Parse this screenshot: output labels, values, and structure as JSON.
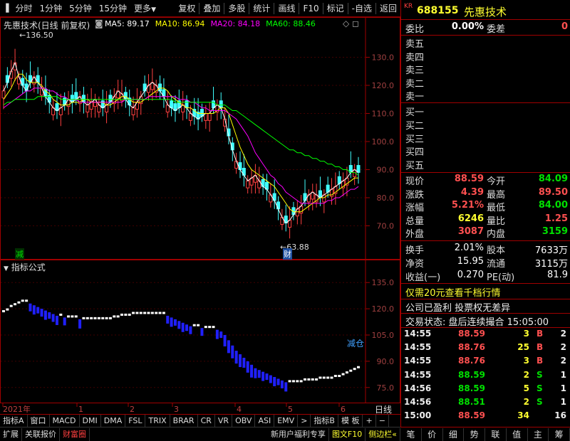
{
  "toolbar": {
    "periods": [
      "分时",
      "1分钟",
      "5分钟",
      "15分钟",
      "更多"
    ],
    "actions": [
      "复权",
      "叠加",
      "多股",
      "统计",
      "画线",
      "F10",
      "标记",
      "-自选",
      "返回"
    ]
  },
  "main": {
    "title": "先惠技术(日线 前复权)",
    "ma_legend": [
      {
        "label": "MA5: 89.17",
        "color": "#ffffff"
      },
      {
        "label": "MA10: 86.94",
        "color": "#ffff00"
      },
      {
        "label": "MA20: 84.18",
        "color": "#ff00ff"
      },
      {
        "label": "MA60: 88.46",
        "color": "#00ff00"
      }
    ],
    "high_label": "136.50",
    "low_label": "63.88",
    "marker_jian": "减",
    "marker_cai": "财"
  },
  "indicator": {
    "title": "指标公式",
    "annotation": "减仓"
  },
  "chart_data": [
    {
      "type": "candlestick",
      "title": "先惠技术(日线 前复权)",
      "y_ticks": [
        130.0,
        120.0,
        110.0,
        100.0,
        90.0,
        80.0,
        70.0
      ],
      "ylim": [
        61,
        140
      ],
      "x_ticks": [
        "2021年",
        "1",
        "2",
        "3",
        "4",
        "5",
        "6"
      ],
      "series": [
        {
          "name": "MA5",
          "color": "#ffffff",
          "values": [
            118,
            121,
            125,
            128,
            123,
            120,
            118,
            121,
            123,
            121,
            119,
            116,
            114,
            112,
            111,
            112,
            113,
            115,
            114,
            115,
            116,
            114,
            113,
            114,
            115,
            113,
            112,
            113,
            114,
            116,
            118,
            117,
            115,
            113,
            112,
            114,
            116,
            118,
            120,
            121,
            120,
            118,
            116,
            113,
            112,
            111,
            112,
            113,
            112,
            110,
            109,
            108,
            109,
            110,
            110,
            112,
            113,
            112,
            108,
            102,
            97,
            93,
            90,
            88,
            86,
            87,
            88,
            86,
            84,
            83,
            81,
            79,
            76,
            73,
            71,
            72,
            74,
            76,
            77,
            79,
            81,
            82,
            81,
            80,
            81,
            82,
            83,
            84,
            85,
            86,
            87,
            89,
            90,
            89
          ]
        },
        {
          "name": "MA10",
          "color": "#ffff00",
          "values": [
            115,
            117,
            119,
            122,
            124,
            124,
            122,
            121,
            121,
            121,
            120,
            118,
            117,
            115,
            114,
            113,
            113,
            113,
            114,
            114,
            114,
            115,
            115,
            114,
            114,
            114,
            114,
            113,
            113,
            114,
            115,
            116,
            116,
            115,
            114,
            114,
            114,
            115,
            116,
            117,
            118,
            119,
            119,
            118,
            116,
            115,
            114,
            113,
            112,
            112,
            111,
            110,
            110,
            110,
            110,
            110,
            111,
            112,
            112,
            110,
            106,
            102,
            98,
            95,
            92,
            90,
            89,
            88,
            87,
            86,
            85,
            84,
            82,
            80,
            78,
            76,
            75,
            75,
            75,
            76,
            77,
            78,
            79,
            80,
            80,
            81,
            81,
            82,
            83,
            84,
            85,
            86,
            87,
            87
          ]
        },
        {
          "name": "MA20",
          "color": "#ff00ff",
          "values": [
            112,
            113,
            114,
            115,
            116,
            117,
            118,
            118,
            119,
            119,
            119,
            119,
            118,
            118,
            117,
            116,
            116,
            115,
            115,
            115,
            114,
            114,
            114,
            114,
            114,
            114,
            114,
            114,
            114,
            114,
            114,
            114,
            115,
            115,
            115,
            115,
            115,
            115,
            116,
            116,
            116,
            116,
            116,
            116,
            116,
            116,
            115,
            115,
            115,
            114,
            114,
            113,
            112,
            112,
            111,
            111,
            111,
            111,
            111,
            110,
            109,
            108,
            106,
            104,
            102,
            99,
            96,
            94,
            92,
            90,
            88,
            87,
            85,
            84,
            82,
            81,
            80,
            79,
            78,
            78,
            78,
            78,
            78,
            78,
            78,
            79,
            79,
            80,
            80,
            81,
            82,
            83,
            83,
            84
          ]
        },
        {
          "name": "MA60",
          "color": "#00ff00",
          "values": [
            113,
            114,
            114,
            115,
            115,
            115,
            115,
            115,
            115,
            116,
            116,
            116,
            116,
            116,
            116,
            115,
            115,
            115,
            115,
            115,
            115,
            115,
            115,
            115,
            115,
            115,
            115,
            115,
            115,
            115,
            115,
            115,
            115,
            115,
            115,
            115,
            115,
            115,
            115,
            115,
            115,
            115,
            115,
            115,
            115,
            114,
            114,
            114,
            114,
            114,
            114,
            114,
            114,
            114,
            114,
            114,
            113,
            113,
            113,
            112,
            111,
            111,
            110,
            109,
            108,
            107,
            106,
            105,
            104,
            103,
            102,
            101,
            100,
            99,
            98,
            97,
            97,
            96,
            96,
            95,
            95,
            94,
            94,
            93,
            93,
            92,
            92,
            91,
            91,
            90,
            90,
            89,
            89,
            88
          ]
        }
      ]
    },
    {
      "type": "bar",
      "title": "指标公式",
      "y_ticks": [
        135.0,
        120.0,
        105.0,
        90.0,
        75.0
      ],
      "ylim": [
        68,
        142
      ],
      "values": [
        118,
        119,
        121,
        122,
        123,
        124,
        124,
        123,
        122,
        121,
        120,
        119,
        118,
        117,
        116,
        116,
        115,
        115,
        115,
        115,
        114,
        114,
        114,
        114,
        114,
        114,
        114,
        114,
        114,
        115,
        115,
        116,
        116,
        116,
        117,
        117,
        117,
        117,
        117,
        117,
        117,
        117,
        117,
        116,
        115,
        114,
        113,
        112,
        111,
        110,
        110,
        110,
        109,
        109,
        109,
        109,
        108,
        107,
        105,
        102,
        99,
        96,
        94,
        92,
        90,
        88,
        86,
        85,
        84,
        83,
        82,
        81,
        80,
        79,
        78,
        78,
        78,
        78,
        78,
        79,
        79,
        79,
        79,
        80,
        80,
        80,
        80,
        81,
        81,
        82,
        83,
        84,
        85,
        86
      ]
    }
  ],
  "bottom": {
    "xaxis_label": "日线",
    "tabs": [
      "指标A",
      "窗口",
      "MACD",
      "DMI",
      "DMA",
      "FSL",
      "TRIX",
      "BRAR",
      "CR",
      "VR",
      "OBV",
      "ASI",
      "EMV",
      ">",
      "指标B",
      "模 板",
      "+",
      "−"
    ],
    "status": [
      "扩展",
      "关联报价",
      "财富圈"
    ],
    "promos": [
      "新用户福利专享",
      "图文F10",
      "侧边栏«"
    ],
    "panel_tabs": [
      "笔",
      "价",
      "细",
      "势",
      "联",
      "值",
      "主",
      "筹"
    ]
  },
  "quote": {
    "market": "KR",
    "code": "688155",
    "name": "先惠技术",
    "weibi_label": "委比",
    "weibi": "0.00%",
    "weicha_label": "委差",
    "weicha": "0",
    "asks": [
      "卖五",
      "卖四",
      "卖三",
      "卖二",
      "卖一"
    ],
    "bids": [
      "买一",
      "买二",
      "买三",
      "买四",
      "买五"
    ],
    "stats": [
      [
        "现价",
        "88.59",
        "今开",
        "84.09"
      ],
      [
        "涨跌",
        "4.39",
        "最高",
        "89.50"
      ],
      [
        "涨幅",
        "5.21%",
        "最低",
        "84.00"
      ],
      [
        "总量",
        "6246",
        "量比",
        "1.25"
      ],
      [
        "外盘",
        "3087",
        "内盘",
        "3159"
      ]
    ],
    "stats_colors": [
      [
        "#ff5050",
        "#00e000"
      ],
      [
        "#ff5050",
        "#ff5050"
      ],
      [
        "#ff5050",
        "#00e000"
      ],
      [
        "#ffff30",
        "#ff5050"
      ],
      [
        "#ff5050",
        "#00e000"
      ]
    ],
    "fund": [
      [
        "换手",
        "2.01%",
        "股本",
        "7633万"
      ],
      [
        "净资",
        "15.95",
        "流通",
        "3115万"
      ],
      [
        "收益(一)",
        "0.270",
        "PE(动)",
        "81.9"
      ]
    ],
    "promo": "仅需20元查看千档行情",
    "notice": "公司已盈利 投票权无差异",
    "trade_status": "交易状态: 盘后连续撮合 15:05:00",
    "ticks": [
      [
        "14:55",
        "88.59",
        "3",
        "B",
        "2",
        "#ff5050"
      ],
      [
        "14:55",
        "88.76",
        "25",
        "B",
        "2",
        "#ff5050"
      ],
      [
        "14:55",
        "88.76",
        "3",
        "B",
        "2",
        "#ff5050"
      ],
      [
        "14:55",
        "88.59",
        "2",
        "S",
        "1",
        "#00e000"
      ],
      [
        "14:56",
        "88.59",
        "5",
        "S",
        "1",
        "#00e000"
      ],
      [
        "14:56",
        "88.51",
        "2",
        "S",
        "1",
        "#00e000"
      ],
      [
        "15:00",
        "88.59",
        "34",
        "",
        "16",
        "#ff5050"
      ]
    ]
  }
}
